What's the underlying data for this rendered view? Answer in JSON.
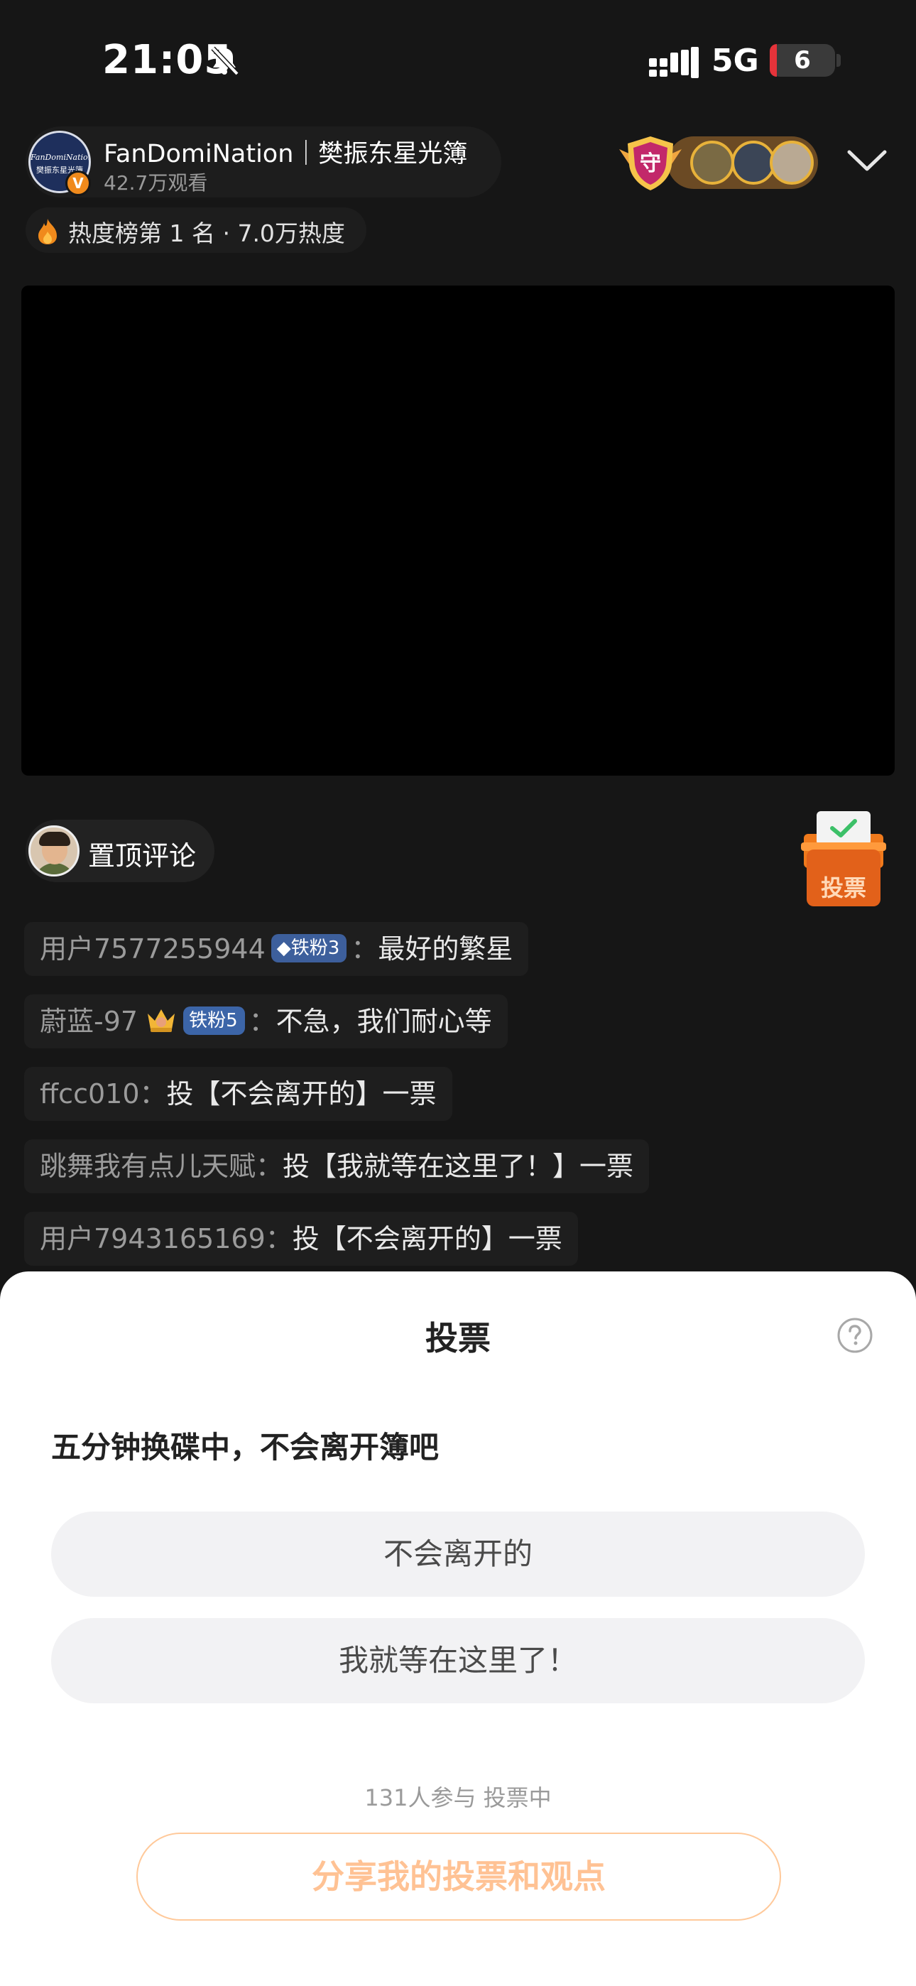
{
  "status_bar": {
    "time": "21:05",
    "network": "5G",
    "battery": "6",
    "battery_color": "#e5333a",
    "icons": [
      "bell-slash-icon",
      "cellular-signal-icon"
    ]
  },
  "host": {
    "name": "FanDomiNation｜樊振东星光簿",
    "viewers": "42.7万观看",
    "avatar_text_line1": "FanDomiNation",
    "avatar_text_line2": "樊振东星光簿",
    "verified_mark": "V",
    "guard_badge_text": "守",
    "heat_text": "热度榜第 1 名 · 7.0万热度"
  },
  "pinned": {
    "label": "置顶评论"
  },
  "vote_entry": {
    "label": "投票"
  },
  "chat": [
    {
      "user": "用户7577255944",
      "badge": "◆铁粉3",
      "message": "最好的繁星"
    },
    {
      "user": "蔚蓝-97",
      "badge": "铁粉5",
      "message": "不急，我们耐心等"
    },
    {
      "user": "ffcc010",
      "message": "投【不会离开的】一票"
    },
    {
      "user": "跳舞我有点儿天赋",
      "message": "投【我就等在这里了！】一票"
    },
    {
      "user": "用户7943165169",
      "message": "投【不会离开的】一票"
    }
  ],
  "chat_separator": "：",
  "vote_sheet": {
    "title": "投票",
    "question": "五分钟换碟中，不会离开簿吧",
    "options": [
      "不会离开的",
      "我就等在这里了！"
    ],
    "stats": "131人参与  投票中",
    "share_button": "分享我的投票和观点",
    "accent_color": "#ffc294"
  }
}
